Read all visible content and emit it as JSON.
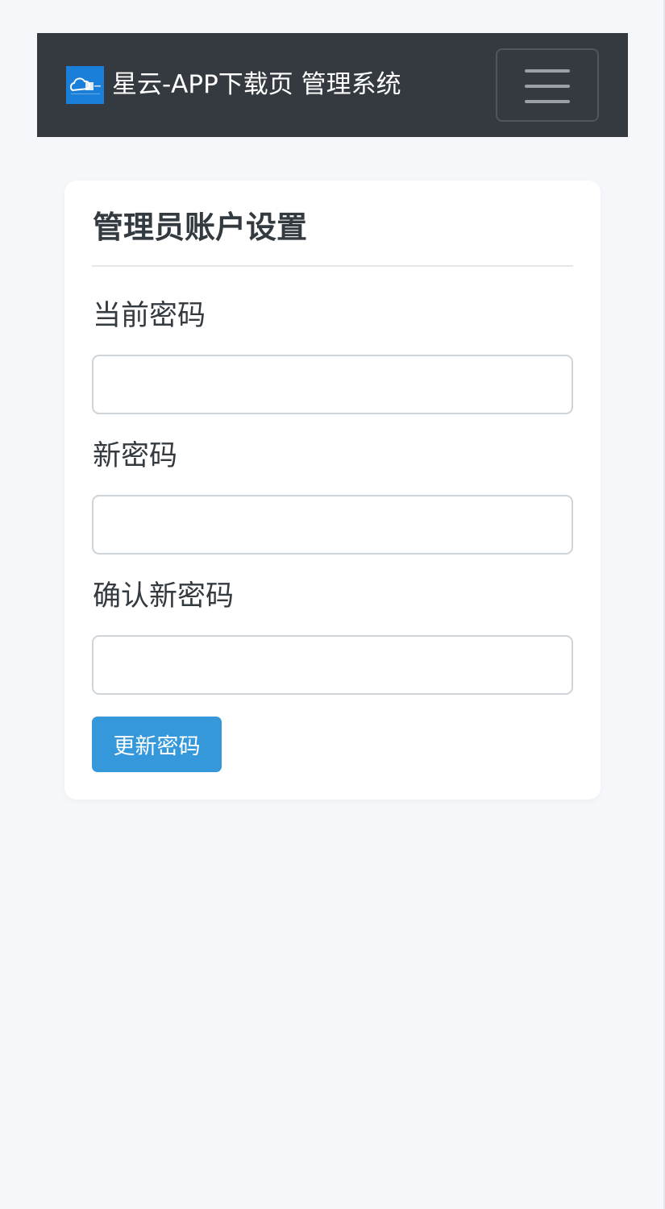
{
  "navbar": {
    "brand_text": "星云-APP下载页 管理系统",
    "logo_icon": "cloud-logo-icon",
    "menu_icon": "hamburger-menu-icon",
    "bg_color": "#343a40"
  },
  "settings": {
    "title": "管理员账户设置",
    "current_password_label": "当前密码",
    "current_password_value": "",
    "new_password_label": "新密码",
    "new_password_value": "",
    "confirm_password_label": "确认新密码",
    "confirm_password_value": "",
    "submit_label": "更新密码",
    "submit_color": "#3498db"
  }
}
